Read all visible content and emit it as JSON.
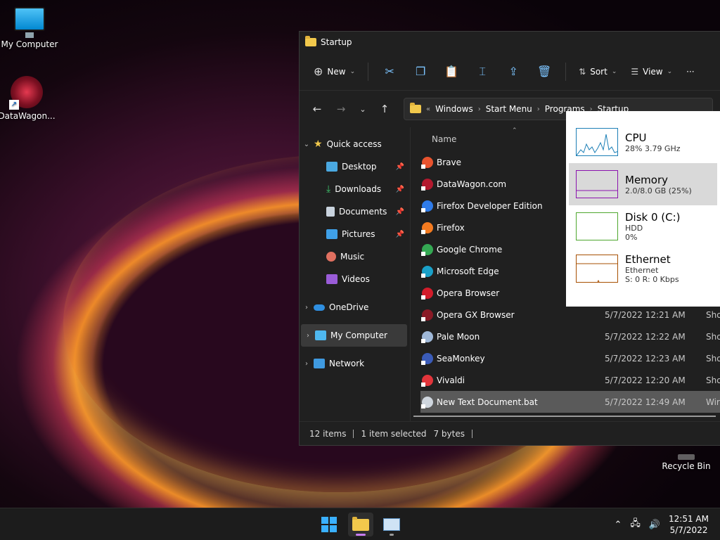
{
  "desktop": {
    "icons": [
      {
        "label": "My Computer"
      },
      {
        "label": "DataWagon..."
      },
      {
        "label": "Recycle Bin"
      }
    ]
  },
  "explorer": {
    "title": "Startup",
    "toolbar": {
      "new_label": "New",
      "sort_label": "Sort",
      "view_label": "View",
      "more_label": "···"
    },
    "breadcrumb": {
      "overflow": "«",
      "items": [
        "Windows",
        "Start Menu",
        "Programs",
        "Startup"
      ]
    },
    "nav": {
      "quick_access": "Quick access",
      "items": [
        "Desktop",
        "Downloads",
        "Documents",
        "Pictures",
        "Music",
        "Videos"
      ],
      "onedrive": "OneDrive",
      "my_computer": "My Computer",
      "network": "Network"
    },
    "columns": {
      "name": "Name"
    },
    "files": [
      {
        "name": "Brave",
        "date": "",
        "type": "",
        "color": "#e8532e"
      },
      {
        "name": "DataWagon.com",
        "date": "",
        "type": "",
        "color": "#b3192e"
      },
      {
        "name": "Firefox Developer Edition",
        "date": "",
        "type": "",
        "color": "#2f7be8"
      },
      {
        "name": "Firefox",
        "date": "",
        "type": "",
        "color": "#f47b20"
      },
      {
        "name": "Google Chrome",
        "date": "",
        "type": "",
        "color": "#34a853"
      },
      {
        "name": "Microsoft Edge",
        "date": "",
        "type": "",
        "color": "#1aa0c8"
      },
      {
        "name": "Opera Browser",
        "date": "",
        "type": "",
        "color": "#d21c2a"
      },
      {
        "name": "Opera GX Browser",
        "date": "5/7/2022 12:21 AM",
        "type": "Sho",
        "color": "#8a1a26"
      },
      {
        "name": "Pale Moon",
        "date": "5/7/2022 12:22 AM",
        "type": "Sho",
        "color": "#9fb8d8"
      },
      {
        "name": "SeaMonkey",
        "date": "5/7/2022 12:23 AM",
        "type": "Sho",
        "color": "#3a5bb8"
      },
      {
        "name": "Vivaldi",
        "date": "5/7/2022 12:20 AM",
        "type": "Sho",
        "color": "#e2353b"
      },
      {
        "name": "New Text Document.bat",
        "date": "5/7/2022 12:49 AM",
        "type": "Wir",
        "color": "#cfd6de"
      }
    ],
    "status": {
      "count": "12 items",
      "selected": "1 item selected",
      "size": "7 bytes"
    }
  },
  "performance": {
    "items": [
      {
        "title": "CPU",
        "line1": "28%  3.79 GHz",
        "line2": "",
        "line3": "",
        "color": "#1c7fb6"
      },
      {
        "title": "Memory",
        "line1": "2.0/8.0 GB (25%)",
        "line2": "",
        "line3": "",
        "color": "#8b12ae"
      },
      {
        "title": "Disk 0 (C:)",
        "line1": "HDD",
        "line2": "0%",
        "line3": "",
        "color": "#4ea72e"
      },
      {
        "title": "Ethernet",
        "line1": "Ethernet",
        "line2": "S: 0  R: 0 Kbps",
        "line3": "",
        "color": "#a74f01"
      }
    ]
  },
  "taskbar": {
    "clock_time": "12:51 AM",
    "clock_date": "5/7/2022"
  }
}
